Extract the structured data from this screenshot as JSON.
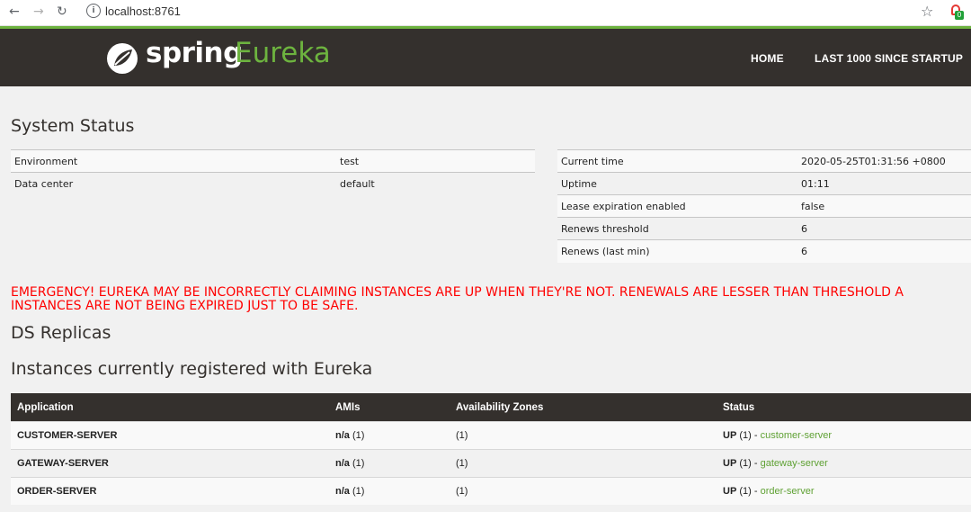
{
  "browser": {
    "url": "localhost:8761",
    "back_icon": "arrow-left-icon",
    "forward_icon": "arrow-right-icon",
    "reload_icon": "reload-icon",
    "extension_badge": "0"
  },
  "header": {
    "brand_spring": "spring",
    "brand_eureka": "Eureka",
    "nav": {
      "home": "HOME",
      "last1000": "LAST 1000 SINCE STARTUP"
    }
  },
  "system_status": {
    "title": "System Status",
    "left": [
      {
        "label": "Environment",
        "value": "test"
      },
      {
        "label": "Data center",
        "value": "default"
      }
    ],
    "right": [
      {
        "label": "Current time",
        "value": "2020-05-25T01:31:56 +0800"
      },
      {
        "label": "Uptime",
        "value": "01:11"
      },
      {
        "label": "Lease expiration enabled",
        "value": "false"
      },
      {
        "label": "Renews threshold",
        "value": "6"
      },
      {
        "label": "Renews (last min)",
        "value": "6"
      }
    ]
  },
  "emergency": {
    "line1": "EMERGENCY! EUREKA MAY BE INCORRECTLY CLAIMING INSTANCES ARE UP WHEN THEY'RE NOT. RENEWALS ARE LESSER THAN THRESHOLD A",
    "line2": "INSTANCES ARE NOT BEING EXPIRED JUST TO BE SAFE."
  },
  "ds_replicas": {
    "title": "DS Replicas"
  },
  "instances": {
    "title": "Instances currently registered with Eureka",
    "headers": {
      "application": "Application",
      "amis": "AMIs",
      "zones": "Availability Zones",
      "status": "Status"
    },
    "rows": [
      {
        "application": "CUSTOMER-SERVER",
        "ami_label": "n/a",
        "ami_count": "(1)",
        "zones": "(1)",
        "status_label": "UP",
        "status_count": "(1)",
        "sep": "-",
        "link": "customer-server"
      },
      {
        "application": "GATEWAY-SERVER",
        "ami_label": "n/a",
        "ami_count": "(1)",
        "zones": "(1)",
        "status_label": "UP",
        "status_count": "(1)",
        "sep": "-",
        "link": "gateway-server"
      },
      {
        "application": "ORDER-SERVER",
        "ami_label": "n/a",
        "ami_count": "(1)",
        "zones": "(1)",
        "status_label": "UP",
        "status_count": "(1)",
        "sep": "-",
        "link": "order-server"
      }
    ]
  },
  "colors": {
    "brand_green": "#6db33f",
    "header_bg": "#34302d",
    "emergency_red": "#ff0000"
  }
}
